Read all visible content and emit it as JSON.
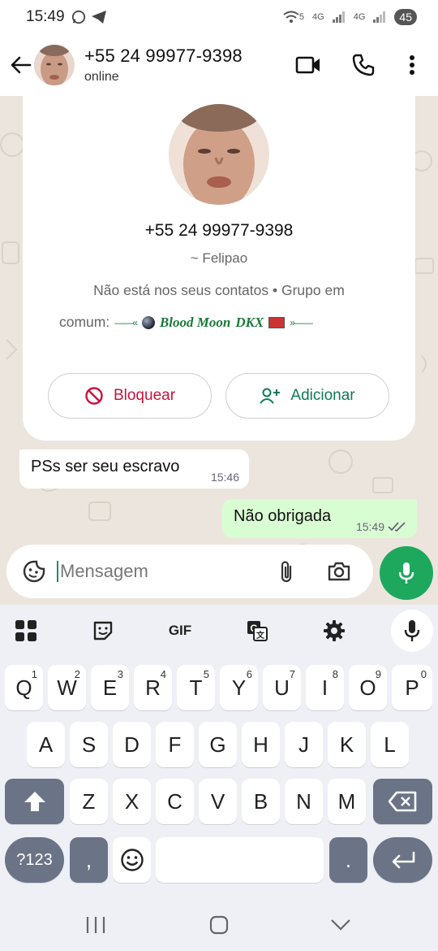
{
  "status_bar": {
    "time": "15:49",
    "network_1": "4G",
    "network_2": "4G",
    "wifi_label": "5",
    "battery": "45"
  },
  "header": {
    "title": "+55 24 99977-9398",
    "subtitle": "online"
  },
  "contact_card": {
    "phone": "+55 24 99977-9398",
    "name": "~ Felipao",
    "not_in_contacts": "Não está nos seus contatos • Grupo em",
    "common_prefix": "comum:",
    "group_name": "Blood Moon",
    "group_suffix": "DKX",
    "block_label": "Bloquear",
    "add_label": "Adicionar"
  },
  "messages": [
    {
      "direction": "in",
      "text": "PSs ser seu escravo",
      "time": "15:46"
    },
    {
      "direction": "out",
      "text": "Não obrigada",
      "time": "15:49"
    }
  ],
  "compose": {
    "placeholder": "Mensagem"
  },
  "keyboard": {
    "toolbar_gif": "GIF",
    "row1": [
      {
        "label": "Q",
        "hint": "1"
      },
      {
        "label": "W",
        "hint": "2"
      },
      {
        "label": "E",
        "hint": "3"
      },
      {
        "label": "R",
        "hint": "4"
      },
      {
        "label": "T",
        "hint": "5"
      },
      {
        "label": "Y",
        "hint": "6"
      },
      {
        "label": "U",
        "hint": "7"
      },
      {
        "label": "I",
        "hint": "8"
      },
      {
        "label": "O",
        "hint": "9"
      },
      {
        "label": "P",
        "hint": "0"
      }
    ],
    "row2": [
      "A",
      "S",
      "D",
      "F",
      "G",
      "H",
      "J",
      "K",
      "L"
    ],
    "row3": [
      "Z",
      "X",
      "C",
      "V",
      "B",
      "N",
      "M"
    ],
    "symbols_label": "?123",
    "comma_label": ",",
    "period_label": "."
  },
  "colors": {
    "accent_green": "#1da85e",
    "block_red": "#c8143c",
    "add_green": "#0f7a55",
    "chat_bg": "#ece5dd",
    "out_bubble": "#d9fdd3"
  }
}
